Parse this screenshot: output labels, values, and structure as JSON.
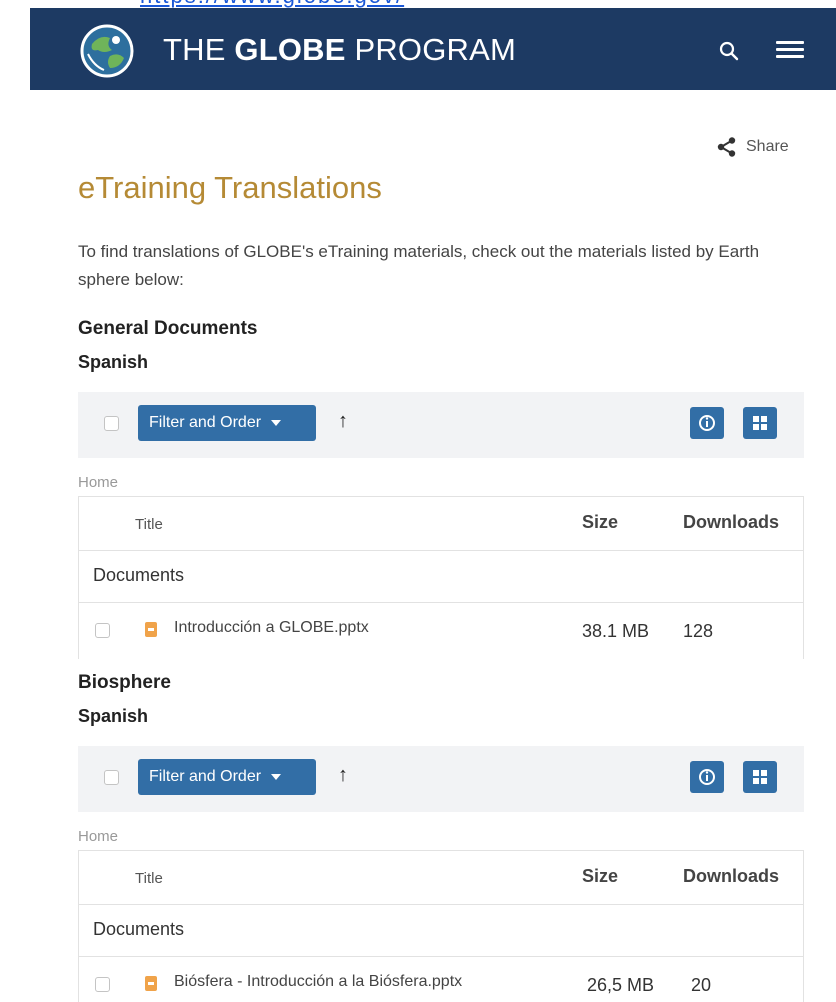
{
  "header": {
    "brand_prefix": "THE ",
    "brand_bold": "GLOBE",
    "brand_suffix": " PROGRAM",
    "bg_color": "#1d3a63",
    "icons": [
      "globe-logo-icon",
      "search-icon",
      "hamburger-menu-icon"
    ]
  },
  "share": {
    "label": "Share",
    "icon": "share-icon"
  },
  "page": {
    "title": "eTraining Translations",
    "title_color": "#b58a35",
    "intro": "To find translations of GLOBE's eTraining materials, check out the materials listed by Earth sphere below:"
  },
  "sections": [
    {
      "title": "General Documents",
      "language": "Spanish",
      "toolbar": {
        "filter_label": "Filter and Order",
        "sort_arrow": "↑"
      },
      "breadcrumb": "Home",
      "columns": {
        "title": "Title",
        "size": "Size",
        "downloads": "Downloads"
      },
      "folder": "Documents",
      "file": {
        "name": "Introducción a GLOBE.pptx",
        "size": "38.1 MB",
        "downloads": "128"
      }
    },
    {
      "title": "Biosphere",
      "language": "Spanish",
      "toolbar": {
        "filter_label": "Filter and Order",
        "sort_arrow": "↑"
      },
      "breadcrumb": "Home",
      "columns": {
        "title": "Title",
        "size": "Size",
        "downloads": "Downloads"
      },
      "folder": "Documents",
      "file": {
        "name": "Biósfera - Introducción a la Biósfera.pptx",
        "size": "26,5 MB",
        "downloads": "20"
      }
    }
  ],
  "colors": {
    "accent_button": "#326ea6",
    "file_icon": "#f0a34a",
    "toolbar_bg": "#f2f3f5"
  }
}
